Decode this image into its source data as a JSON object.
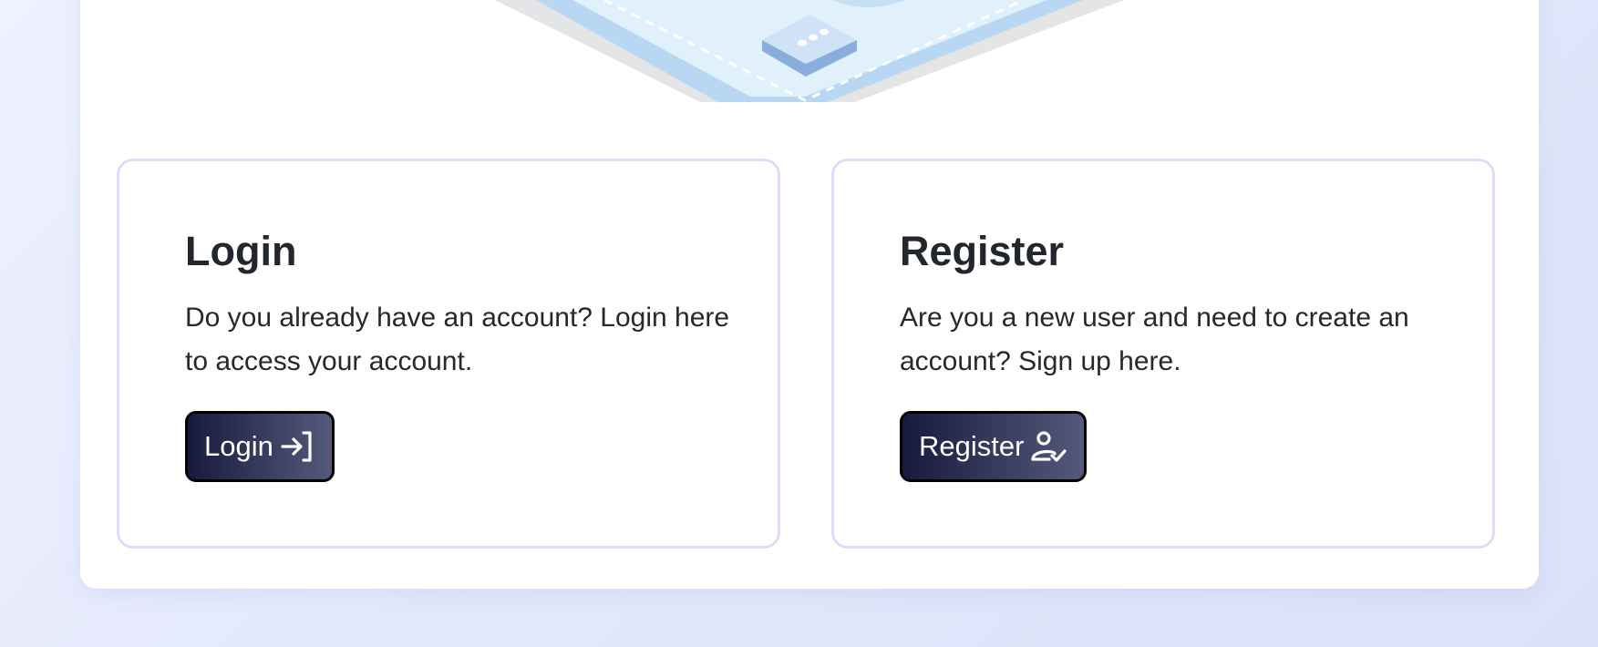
{
  "login": {
    "title": "Login",
    "description": "Do you already have an account? Login here to access your account.",
    "button_label": "Login",
    "button_icon": "login-arrow-icon"
  },
  "register": {
    "title": "Register",
    "description": "Are you a new user and need to create an account? Sign up here.",
    "button_label": "Register",
    "button_icon": "user-check-icon"
  },
  "colors": {
    "page_background": "#e3e8fb",
    "card_border": "#d9defa",
    "button_gradient_start": "#171a3c",
    "button_gradient_end": "#555a7c",
    "heading_text": "#22262d"
  }
}
